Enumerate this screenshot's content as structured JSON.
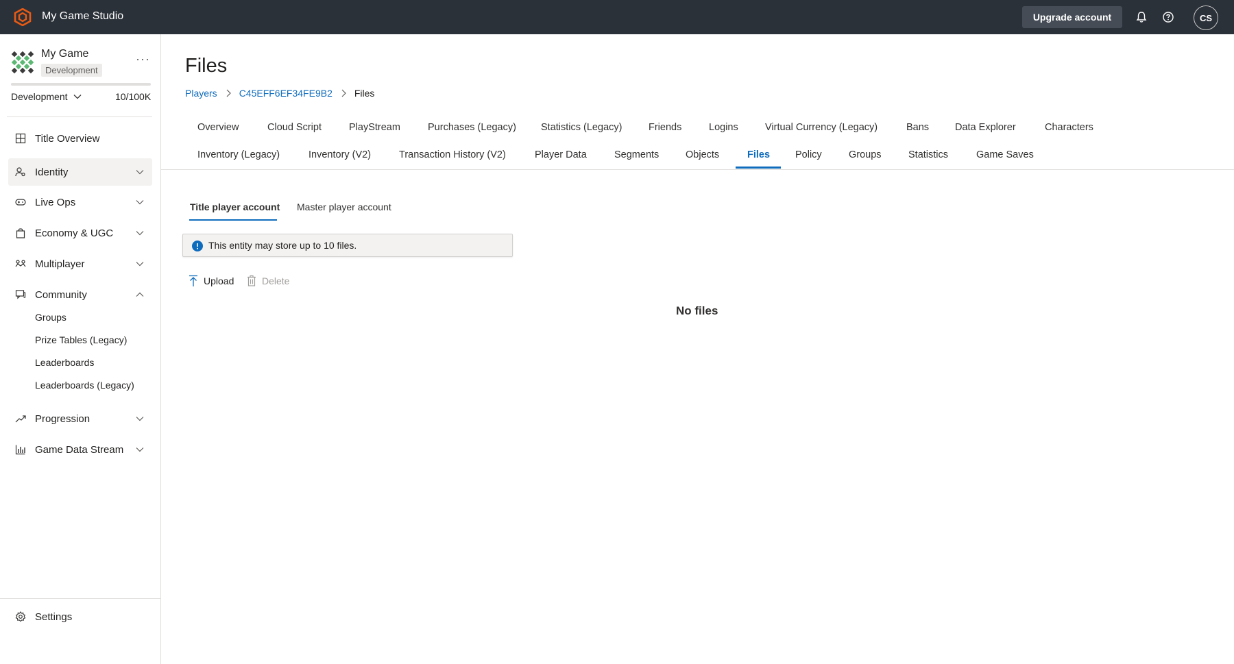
{
  "topbar": {
    "app_title": "My Game Studio",
    "upgrade_label": "Upgrade account",
    "avatar_initials": "CS",
    "icons": [
      "bell-icon",
      "help-icon"
    ],
    "brand_color": "#e95b14"
  },
  "sidebar": {
    "game_name": "My Game",
    "environment_badge": "Development",
    "environment_select": "Development",
    "quota": "10/100K",
    "items": [
      {
        "label": "Title Overview",
        "icon": "grid-icon"
      },
      {
        "label": "Identity",
        "icon": "identity-icon",
        "expanded": false,
        "selected": true
      },
      {
        "label": "Live Ops",
        "icon": "gamepad-icon",
        "expanded": false
      },
      {
        "label": "Economy & UGC",
        "icon": "shopping-bag-icon",
        "expanded": false
      },
      {
        "label": "Multiplayer",
        "icon": "multiplayer-icon",
        "expanded": false
      },
      {
        "label": "Community",
        "icon": "chat-icon",
        "expanded": true
      },
      {
        "label": "Progression",
        "icon": "trend-icon",
        "expanded": false
      },
      {
        "label": "Game Data Stream",
        "icon": "bar-chart-icon",
        "expanded": false
      }
    ],
    "community_subitems": [
      "Groups",
      "Prize Tables (Legacy)",
      "Leaderboards",
      "Leaderboards (Legacy)"
    ],
    "settings_label": "Settings"
  },
  "main": {
    "title": "Files",
    "breadcrumb": [
      "Players",
      "C45EFF6EF34FE9B2",
      "Files"
    ],
    "tabs_row1": [
      "Overview",
      "Cloud Script",
      "PlayStream",
      "Purchases (Legacy)",
      "Statistics (Legacy)",
      "Friends",
      "Logins",
      "Virtual Currency (Legacy)",
      "Bans",
      "Data Explorer",
      "Characters"
    ],
    "tabs_row2": [
      "Inventory (Legacy)",
      "Inventory (V2)",
      "Transaction History (V2)",
      "Player Data",
      "Segments",
      "Objects",
      "Files",
      "Policy",
      "Groups",
      "Statistics",
      "Game Saves"
    ],
    "active_tab": "Files",
    "subtabs": [
      "Title player account",
      "Master player account"
    ],
    "active_subtab": "Title player account",
    "info_message": "This entity may store up to 10 files.",
    "upload_label": "Upload",
    "delete_label": "Delete",
    "empty_message": "No files",
    "accent_color": "#0f6cbd"
  }
}
